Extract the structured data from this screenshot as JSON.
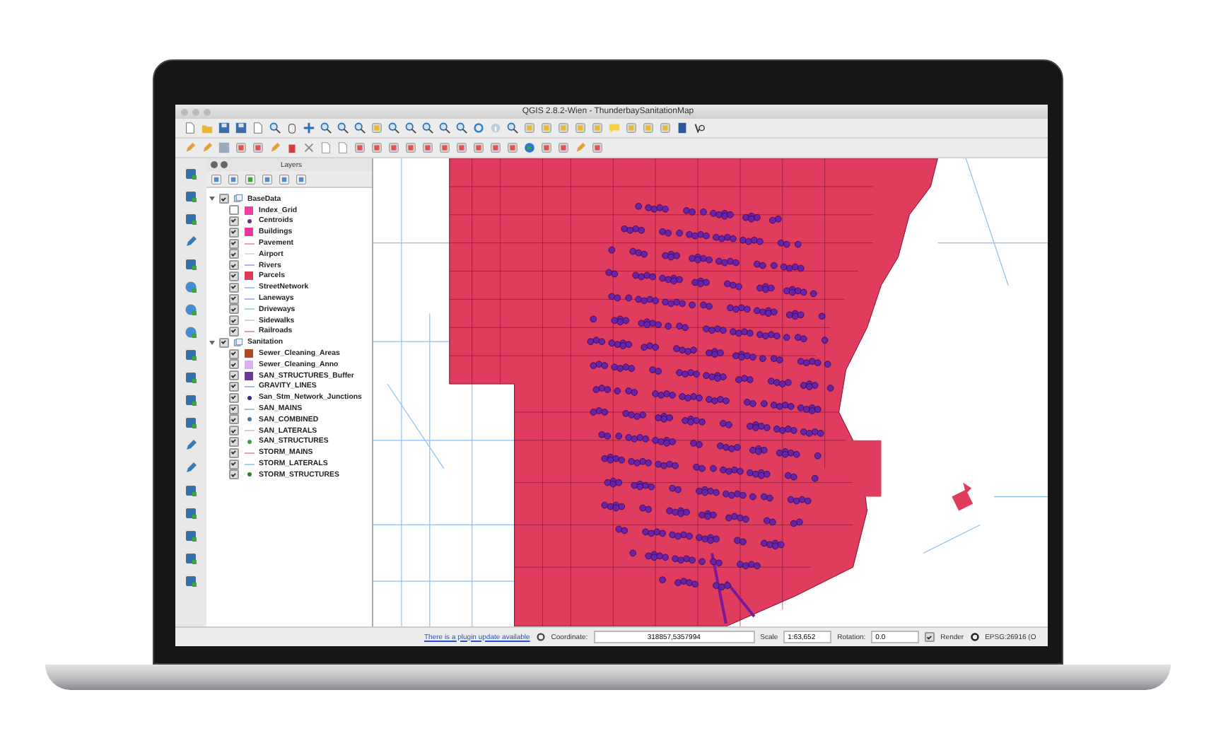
{
  "window": {
    "title": "QGIS 2.8.2-Wien - ThunderbaySanitationMap"
  },
  "layers_panel": {
    "title": "Layers",
    "groups": [
      {
        "name": "BaseData",
        "checked": true,
        "expanded": true,
        "children": [
          {
            "name": "Index_Grid",
            "checked": false,
            "kind": "fill",
            "color": "#e8449a"
          },
          {
            "name": "Centroids",
            "checked": true,
            "kind": "point",
            "color": "#6a2c8a"
          },
          {
            "name": "Buildings",
            "checked": true,
            "kind": "fill",
            "color": "#e6399b"
          },
          {
            "name": "Pavement",
            "checked": true,
            "kind": "line",
            "color": "#f0a0a0"
          },
          {
            "name": "Airport",
            "checked": true,
            "kind": "line",
            "color": "#e0dccc"
          },
          {
            "name": "Rivers",
            "checked": true,
            "kind": "line",
            "color": "#d0a0f0"
          },
          {
            "name": "Parcels",
            "checked": true,
            "kind": "fill",
            "color": "#e03a5a"
          },
          {
            "name": "StreetNetwork",
            "checked": true,
            "kind": "line",
            "color": "#a0c8f0"
          },
          {
            "name": "Laneways",
            "checked": true,
            "kind": "line",
            "color": "#a0c0f0"
          },
          {
            "name": "Driveways",
            "checked": true,
            "kind": "line",
            "color": "#a0e0d0"
          },
          {
            "name": "Sidewalks",
            "checked": true,
            "kind": "line",
            "color": "#c0e0d0"
          },
          {
            "name": "Railroads",
            "checked": true,
            "kind": "line",
            "color": "#e0a0a0"
          }
        ]
      },
      {
        "name": "Sanitation",
        "checked": true,
        "expanded": true,
        "children": [
          {
            "name": "Sewer_Cleaning_Areas",
            "checked": true,
            "kind": "fill",
            "color": "#b5452a"
          },
          {
            "name": "Sewer_Cleaning_Anno",
            "checked": true,
            "kind": "fill",
            "color": "#d8b0f0"
          },
          {
            "name": "SAN_STRUCTURES_Buffer",
            "checked": true,
            "kind": "fill",
            "color": "#6a3a9a"
          },
          {
            "name": "GRAVITY_LINES",
            "checked": true,
            "kind": "line",
            "color": "#a0c0f0"
          },
          {
            "name": "San_Stm_Network_Junctions",
            "checked": true,
            "kind": "point",
            "color": "#3a2a8a"
          },
          {
            "name": "SAN_MAINS",
            "checked": true,
            "kind": "line",
            "color": "#a0c8e0"
          },
          {
            "name": "SAN_COMBINED",
            "checked": true,
            "kind": "point",
            "color": "#4a7aa0"
          },
          {
            "name": "SAN_LATERALS",
            "checked": true,
            "kind": "line",
            "color": "#d0d0d0"
          },
          {
            "name": "SAN_STRUCTURES",
            "checked": true,
            "kind": "point",
            "color": "#40a040"
          },
          {
            "name": "STORM_MAINS",
            "checked": true,
            "kind": "line",
            "color": "#f0a0b0"
          },
          {
            "name": "STORM_LATERALS",
            "checked": true,
            "kind": "line",
            "color": "#a0d0f0"
          },
          {
            "name": "STORM_STRUCTURES",
            "checked": true,
            "kind": "point",
            "color": "#308030"
          }
        ]
      }
    ]
  },
  "status_bar": {
    "plugin_link": "There is a plugin update available",
    "coordinate_label": "Coordinate:",
    "coordinate": "318857,5357994",
    "scale_label": "Scale",
    "scale": "1:63,652",
    "rotation_label": "Rotation:",
    "rotation": "0.0",
    "render": {
      "label": "Render",
      "checked": true
    },
    "crs": "EPSG:26916 (O"
  }
}
